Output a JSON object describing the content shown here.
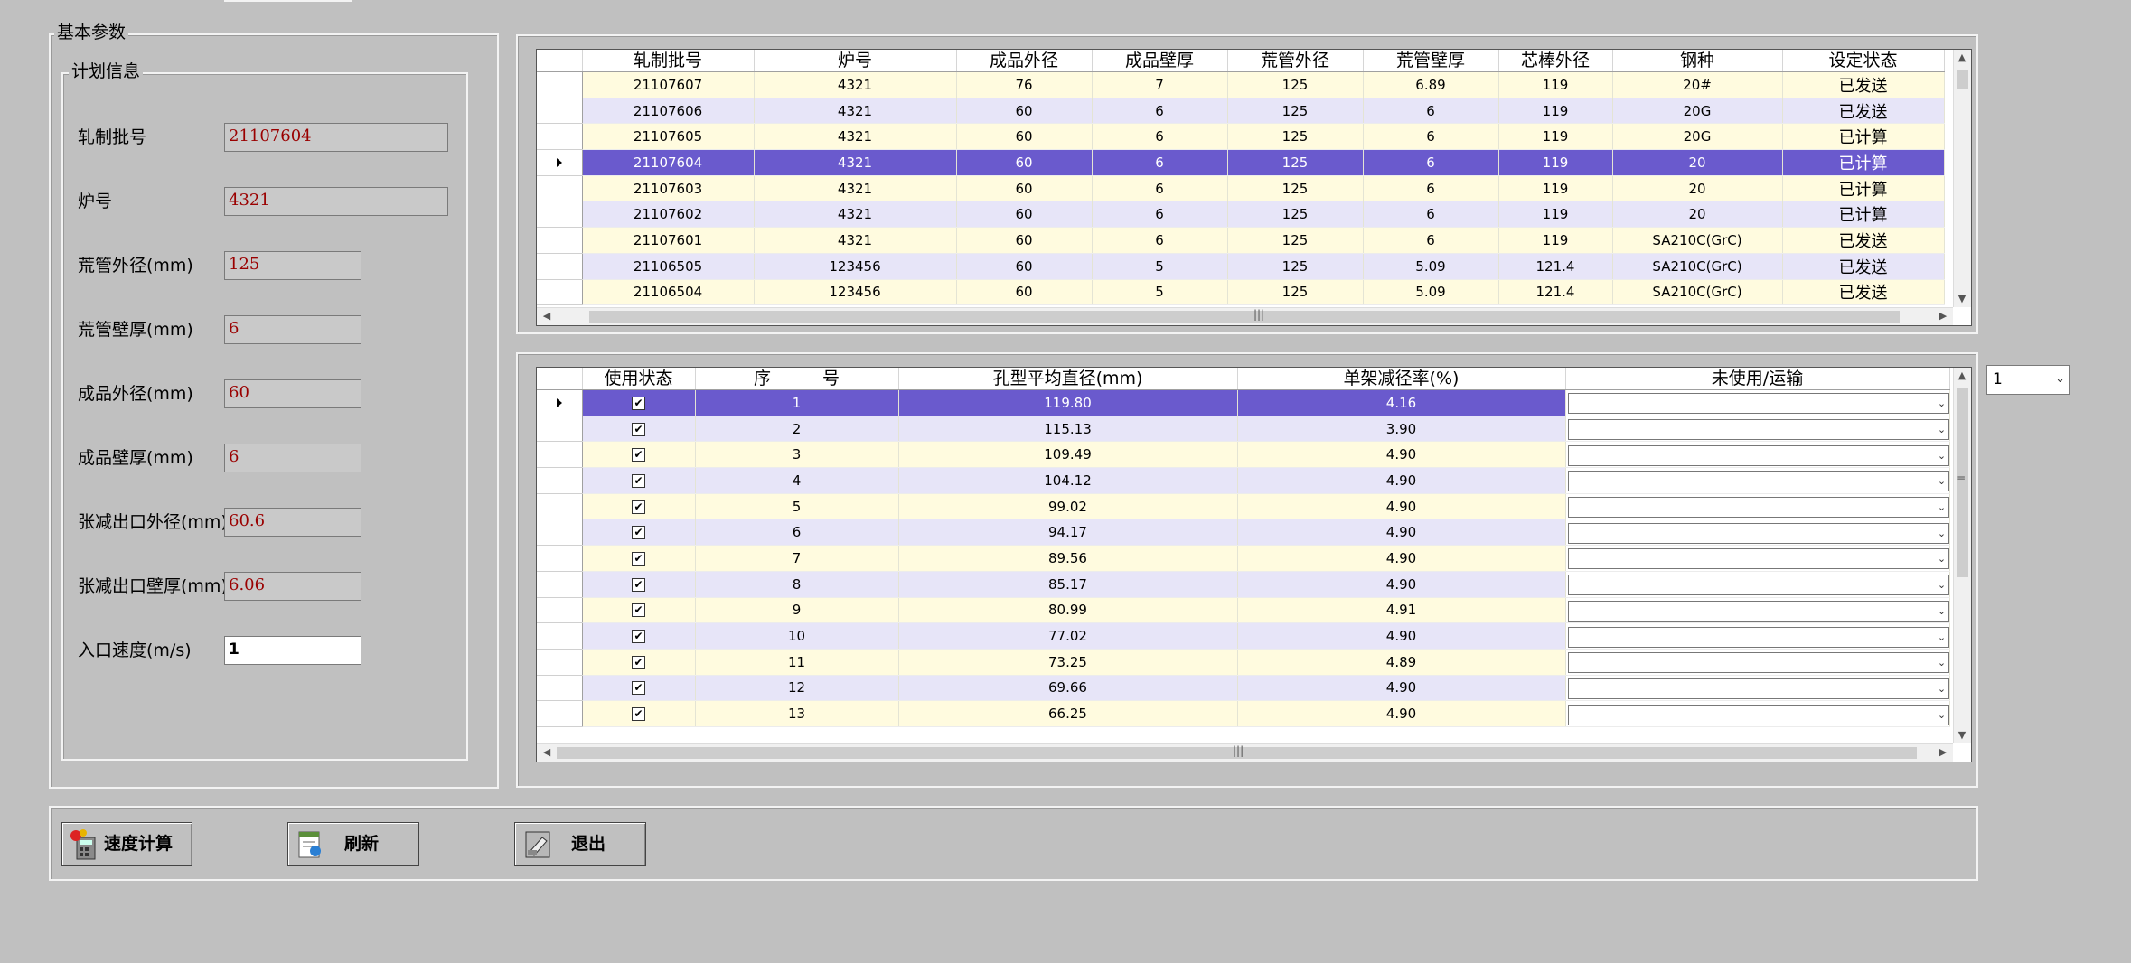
{
  "groups": {
    "basic_params": "基本参数",
    "plan_info": "计划信息"
  },
  "form": {
    "fields": [
      {
        "label": "轧制批号",
        "value": "21107604"
      },
      {
        "label": "炉号",
        "value": "4321"
      },
      {
        "label": "荒管外径(mm)",
        "value": "125"
      },
      {
        "label": "荒管壁厚(mm)",
        "value": "6"
      },
      {
        "label": "成品外径(mm)",
        "value": "60"
      },
      {
        "label": "成品壁厚(mm)",
        "value": "6"
      },
      {
        "label": "张减出口外径(mm)",
        "value": "60.6"
      },
      {
        "label": "张减出口壁厚(mm)",
        "value": "6.06"
      },
      {
        "label": "入口速度(m/s)",
        "value": "1"
      }
    ]
  },
  "batch_grid": {
    "columns": [
      "轧制批号",
      "炉号",
      "成品外径",
      "成品壁厚",
      "荒管外径",
      "荒管壁厚",
      "芯棒外径",
      "钢种",
      "设定状态"
    ],
    "selected_index": 3,
    "rows": [
      [
        "21107607",
        "4321",
        "76",
        "7",
        "125",
        "6.89",
        "119",
        "20#",
        "已发送"
      ],
      [
        "21107606",
        "4321",
        "60",
        "6",
        "125",
        "6",
        "119",
        "20G",
        "已发送"
      ],
      [
        "21107605",
        "4321",
        "60",
        "6",
        "125",
        "6",
        "119",
        "20G",
        "已计算"
      ],
      [
        "21107604",
        "4321",
        "60",
        "6",
        "125",
        "6",
        "119",
        "20",
        "已计算"
      ],
      [
        "21107603",
        "4321",
        "60",
        "6",
        "125",
        "6",
        "119",
        "20",
        "已计算"
      ],
      [
        "21107602",
        "4321",
        "60",
        "6",
        "125",
        "6",
        "119",
        "20",
        "已计算"
      ],
      [
        "21107601",
        "4321",
        "60",
        "6",
        "125",
        "6",
        "119",
        "SA210C(GrC)",
        "已发送"
      ],
      [
        "21106505",
        "123456",
        "60",
        "5",
        "125",
        "5.09",
        "121.4",
        "SA210C(GrC)",
        "已发送"
      ],
      [
        "21106504",
        "123456",
        "60",
        "5",
        "125",
        "5.09",
        "121.4",
        "SA210C(GrC)",
        "已发送"
      ]
    ]
  },
  "stand_grid": {
    "columns": [
      "使用状态",
      "序　　　号",
      "孔型平均直径(mm)",
      "单架减径率(%)",
      "未使用/运输"
    ],
    "selected_index": 0,
    "rows": [
      {
        "seq": "1",
        "diameter": "119.80",
        "rate": "4.16"
      },
      {
        "seq": "2",
        "diameter": "115.13",
        "rate": "3.90"
      },
      {
        "seq": "3",
        "diameter": "109.49",
        "rate": "4.90"
      },
      {
        "seq": "4",
        "diameter": "104.12",
        "rate": "4.90"
      },
      {
        "seq": "5",
        "diameter": "99.02",
        "rate": "4.90"
      },
      {
        "seq": "6",
        "diameter": "94.17",
        "rate": "4.90"
      },
      {
        "seq": "7",
        "diameter": "89.56",
        "rate": "4.90"
      },
      {
        "seq": "8",
        "diameter": "85.17",
        "rate": "4.90"
      },
      {
        "seq": "9",
        "diameter": "80.99",
        "rate": "4.91"
      },
      {
        "seq": "10",
        "diameter": "77.02",
        "rate": "4.90"
      },
      {
        "seq": "11",
        "diameter": "73.25",
        "rate": "4.89"
      },
      {
        "seq": "12",
        "diameter": "69.66",
        "rate": "4.90"
      },
      {
        "seq": "13",
        "diameter": "66.25",
        "rate": "4.90"
      }
    ]
  },
  "side_select": {
    "value": "1"
  },
  "buttons": {
    "calc": "速度计算",
    "refresh": "刷新",
    "exit": "退出"
  },
  "icons": {
    "calc": "calculator-icon",
    "refresh": "refresh-icon",
    "exit": "exit-icon",
    "row_indicator": "row-pointer-icon",
    "checkbox": "checkbox-checked-icon",
    "dropdown": "chevron-down-icon"
  },
  "colors": {
    "background": "#c0c0c0",
    "row_odd": "#fffbdf",
    "row_even": "#e7e5f8",
    "row_selected": "#6a5acd",
    "field_value_text": "#9a0000"
  }
}
